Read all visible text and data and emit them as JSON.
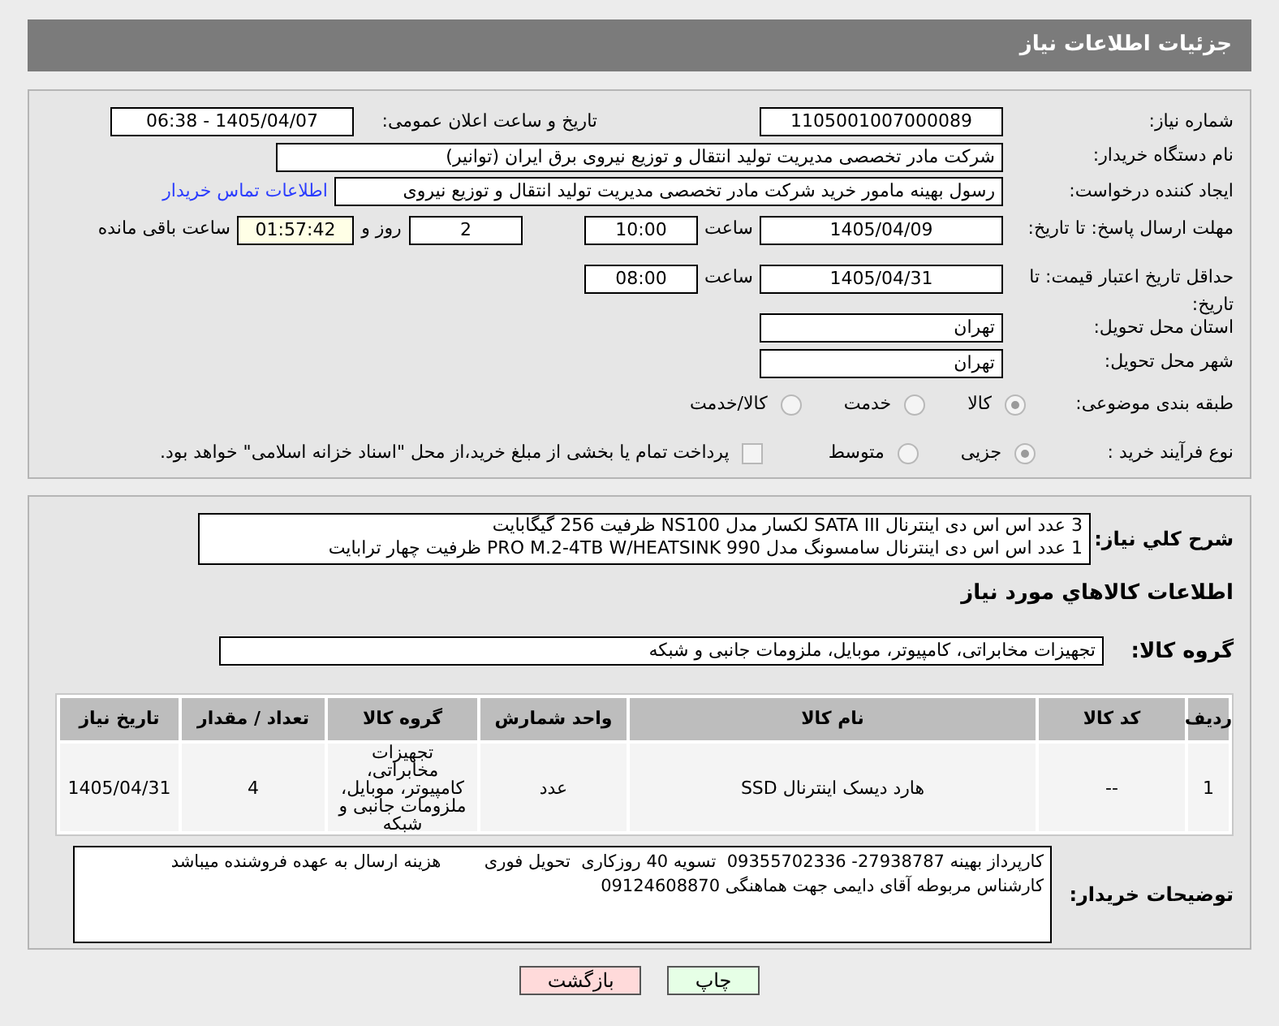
{
  "header": {
    "title": "جزئیات اطلاعات نیاز"
  },
  "need_number": {
    "label": "شماره نیاز:",
    "value": "1105001007000089"
  },
  "announce": {
    "label": "تاریخ و ساعت اعلان عمومی:",
    "value": "1405/04/07 - 06:38"
  },
  "buyer": {
    "label": "نام دستگاه خریدار:",
    "value": "شرکت مادر تخصصی مدیریت تولید  انتقال و توزیع نیروی برق ایران (توانیر)"
  },
  "creator": {
    "label": "ایجاد کننده درخواست:",
    "value": "رسول بهینه مامور خرید شرکت مادر تخصصی مدیریت تولید  انتقال و توزیع نیروی",
    "link": "اطلاعات تماس خریدار"
  },
  "deadline": {
    "label": "مهلت ارسال پاسخ: تا تاریخ:",
    "date": "1405/04/09",
    "time_label": "ساعت",
    "time": "10:00",
    "days": "2",
    "days_label": "روز و",
    "remaining": "01:57:42",
    "remaining_label": "ساعت باقی مانده"
  },
  "validity": {
    "label": "حداقل تاریخ اعتبار قیمت: تا تاریخ:",
    "date": "1405/04/31",
    "time_label": "ساعت",
    "time": "08:00"
  },
  "province": {
    "label": "استان محل تحویل:",
    "value": "تهران"
  },
  "city": {
    "label": "شهر محل تحویل:",
    "value": "تهران"
  },
  "category": {
    "label": "طبقه بندی موضوعی:",
    "options": [
      {
        "label": "کالا",
        "selected": true
      },
      {
        "label": "خدمت",
        "selected": false
      },
      {
        "label": "کالا/خدمت",
        "selected": false
      }
    ]
  },
  "process": {
    "label": "نوع فرآیند خرید :",
    "options": [
      {
        "label": "جزیی",
        "selected": true
      },
      {
        "label": "متوسط",
        "selected": false
      }
    ],
    "checkbox": {
      "label": "پرداخت تمام یا بخشی از مبلغ خرید،از محل \"اسناد خزانه اسلامی\" خواهد بود.",
      "checked": false
    }
  },
  "description": {
    "label": "شرح کلي نياز:",
    "lines": [
      "3 عدد اس اس دی اینترنال SATA III لکسار مدل NS100 ظرفیت 256 گیگابایت",
      "1 عدد اس اس دی اینترنال سامسونگ مدل PRO M.2-4TB W/HEATSINK 990 ظرفیت چهار ترابایت"
    ]
  },
  "goods_title": "اطلاعات کالاهاي مورد نياز",
  "group": {
    "label": "گروه کالا:",
    "value": "تجهیزات مخابراتی، کامپیوتر، موبایل، ملزومات جانبی و شبکه"
  },
  "table": {
    "columns": [
      "ردیف",
      "کد کالا",
      "نام کالا",
      "واحد شمارش",
      "گروه کالا",
      "تعداد / مقدار",
      "تاریخ نیاز"
    ],
    "rows": [
      [
        "1",
        "--",
        "هارد دیسک اینترنال SSD",
        "عدد",
        "تجهیزات مخابراتی، کامپیوتر، موبایل، ملزومات جانبی و شبکه",
        "4",
        "1405/04/31"
      ]
    ]
  },
  "buyer_notes": {
    "label": "توضیحات خریدار:",
    "lines": [
      "کارپرداز بهینه 27938787- 09355702336  تسویه 40 روزکاری  تحویل فوری        هزینه ارسال به عهده فروشنده میباشد",
      "کارشناس مربوطه آقای دایمی جهت هماهنگی 09124608870"
    ]
  },
  "buttons": [
    {
      "label": "چاپ",
      "kind": "print"
    },
    {
      "label": "بازگشت",
      "kind": "back"
    }
  ]
}
